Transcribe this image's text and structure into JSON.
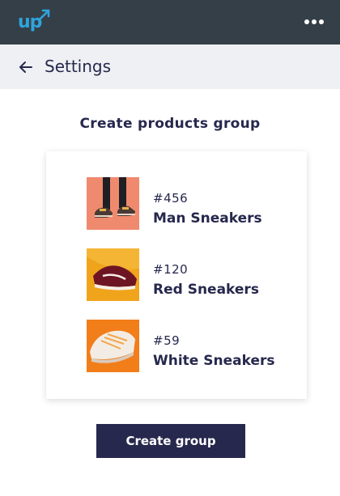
{
  "topbar": {
    "logo_text": "up",
    "accent_color": "#2fa4dc",
    "background_color": "#343f48",
    "menu_icon": "more-horizontal-icon"
  },
  "header": {
    "back_icon": "arrow-left-icon",
    "title": "Settings"
  },
  "main": {
    "title": "Create products group",
    "products": [
      {
        "id": "#456",
        "name": "Man Sneakers",
        "thumb_color": "#f08a6e"
      },
      {
        "id": "#120",
        "name": "Red Sneakers",
        "thumb_color": "#f0a41c"
      },
      {
        "id": "#59",
        "name": "White Sneakers",
        "thumb_color": "#f27e1a"
      }
    ],
    "create_button": "Create group",
    "button_color": "#26284d"
  }
}
